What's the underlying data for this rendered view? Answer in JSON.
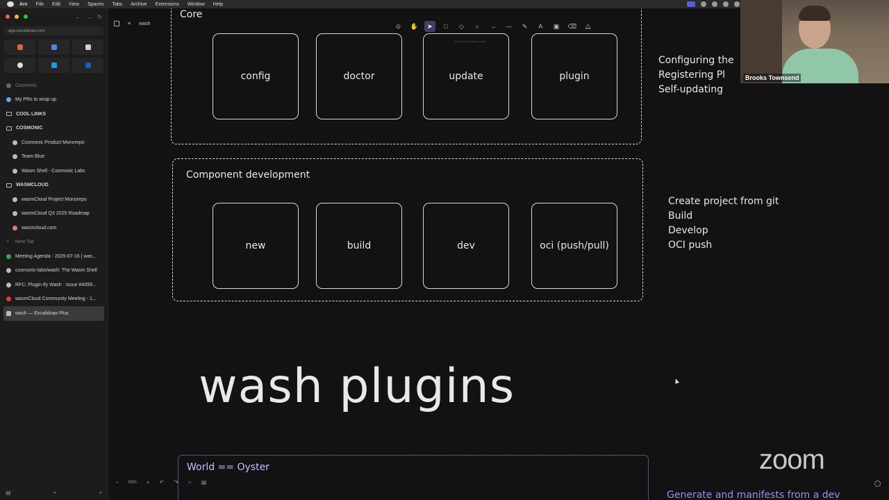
{
  "menubar": {
    "items": [
      "Arc",
      "File",
      "Edit",
      "View",
      "Spaces",
      "Tabs",
      "Archive",
      "Extensions",
      "Help",
      "Window",
      "Help"
    ]
  },
  "sidebar": {
    "url": "app.excalidraw.com",
    "space_label": "Cosmonic",
    "items": [
      {
        "label": "My PRs to wrap up"
      },
      {
        "label": "COOL LINKS"
      },
      {
        "label": "COSMONIC"
      },
      {
        "label": "Cosmonic Product Monorepo"
      },
      {
        "label": "Team Blue"
      },
      {
        "label": "Wasm Shell - Cosmonic Labs"
      },
      {
        "label": "WASMCLOUD"
      },
      {
        "label": "wasmCloud Project Monorepo"
      },
      {
        "label": "wasmCloud Q3 2025 Roadmap"
      },
      {
        "label": "wasmcloud.com"
      },
      {
        "label": "New Tab"
      },
      {
        "label": "Meeting Agenda - 2025-07-16 | was..."
      },
      {
        "label": "cosmonic-labs/wash: The Wasm Shell"
      },
      {
        "label": "RFC: Plugin-ify Wash · Issue #4059..."
      },
      {
        "label": "wasmCloud Community Meeting - 1..."
      },
      {
        "label": "wash — Excalidraw Plus"
      }
    ]
  },
  "canvas": {
    "doc_name": "wash",
    "toolbar_hint": "hold Ctrl or Shift to create",
    "core": {
      "title": "Core",
      "boxes": [
        "config",
        "doctor",
        "update",
        "plugin"
      ],
      "notes": "Configuring the\nRegistering Pl\nSelf-updating"
    },
    "component": {
      "title": "Component development",
      "boxes": [
        "new",
        "build",
        "dev",
        "oci (push/pull)"
      ],
      "notes": "Create project from git\nBuild\nDevelop\nOCI push"
    },
    "big_title": "wash plugins",
    "oyster_title": "World == Oyster",
    "cutoff_text": "Generate  and  manifests  from  a  dev",
    "zoom_level": "93%"
  },
  "webcam": {
    "name": "Brooks Townsend"
  },
  "zoom_brand": "zoom"
}
